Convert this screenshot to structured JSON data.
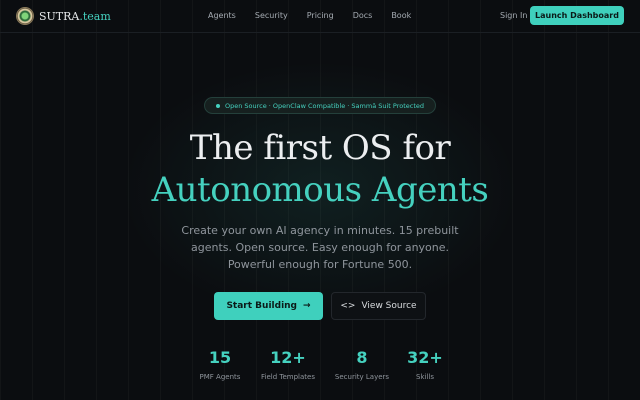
{
  "brand": {
    "name": "SUTRA",
    "accent": ".team",
    "accent_color": "#45d1bf"
  },
  "nav": {
    "links": [
      "Agents",
      "Security",
      "Pricing",
      "Docs",
      "Book"
    ],
    "signin": "Sign In",
    "launch": "Launch Dashboard"
  },
  "hero": {
    "pill": "Open Source · OpenClaw Compatible · Sammā Suit Protected",
    "title_line1": "The first OS for",
    "title_line2": "Autonomous Agents",
    "subtitle": "Create your own AI agency in minutes. 15 prebuilt agents. Open source. Easy enough for anyone. Powerful enough for Fortune 500.",
    "primary_cta": "Start Building",
    "primary_icon": "arrow-right-icon",
    "secondary_cta": "View Source",
    "secondary_icon": "code-icon"
  },
  "stats": [
    {
      "value": "15",
      "label": "PMF Agents"
    },
    {
      "value": "12+",
      "label": "Field Templates"
    },
    {
      "value": "8",
      "label": "Security Layers"
    },
    {
      "value": "32+",
      "label": "Skills"
    }
  ]
}
